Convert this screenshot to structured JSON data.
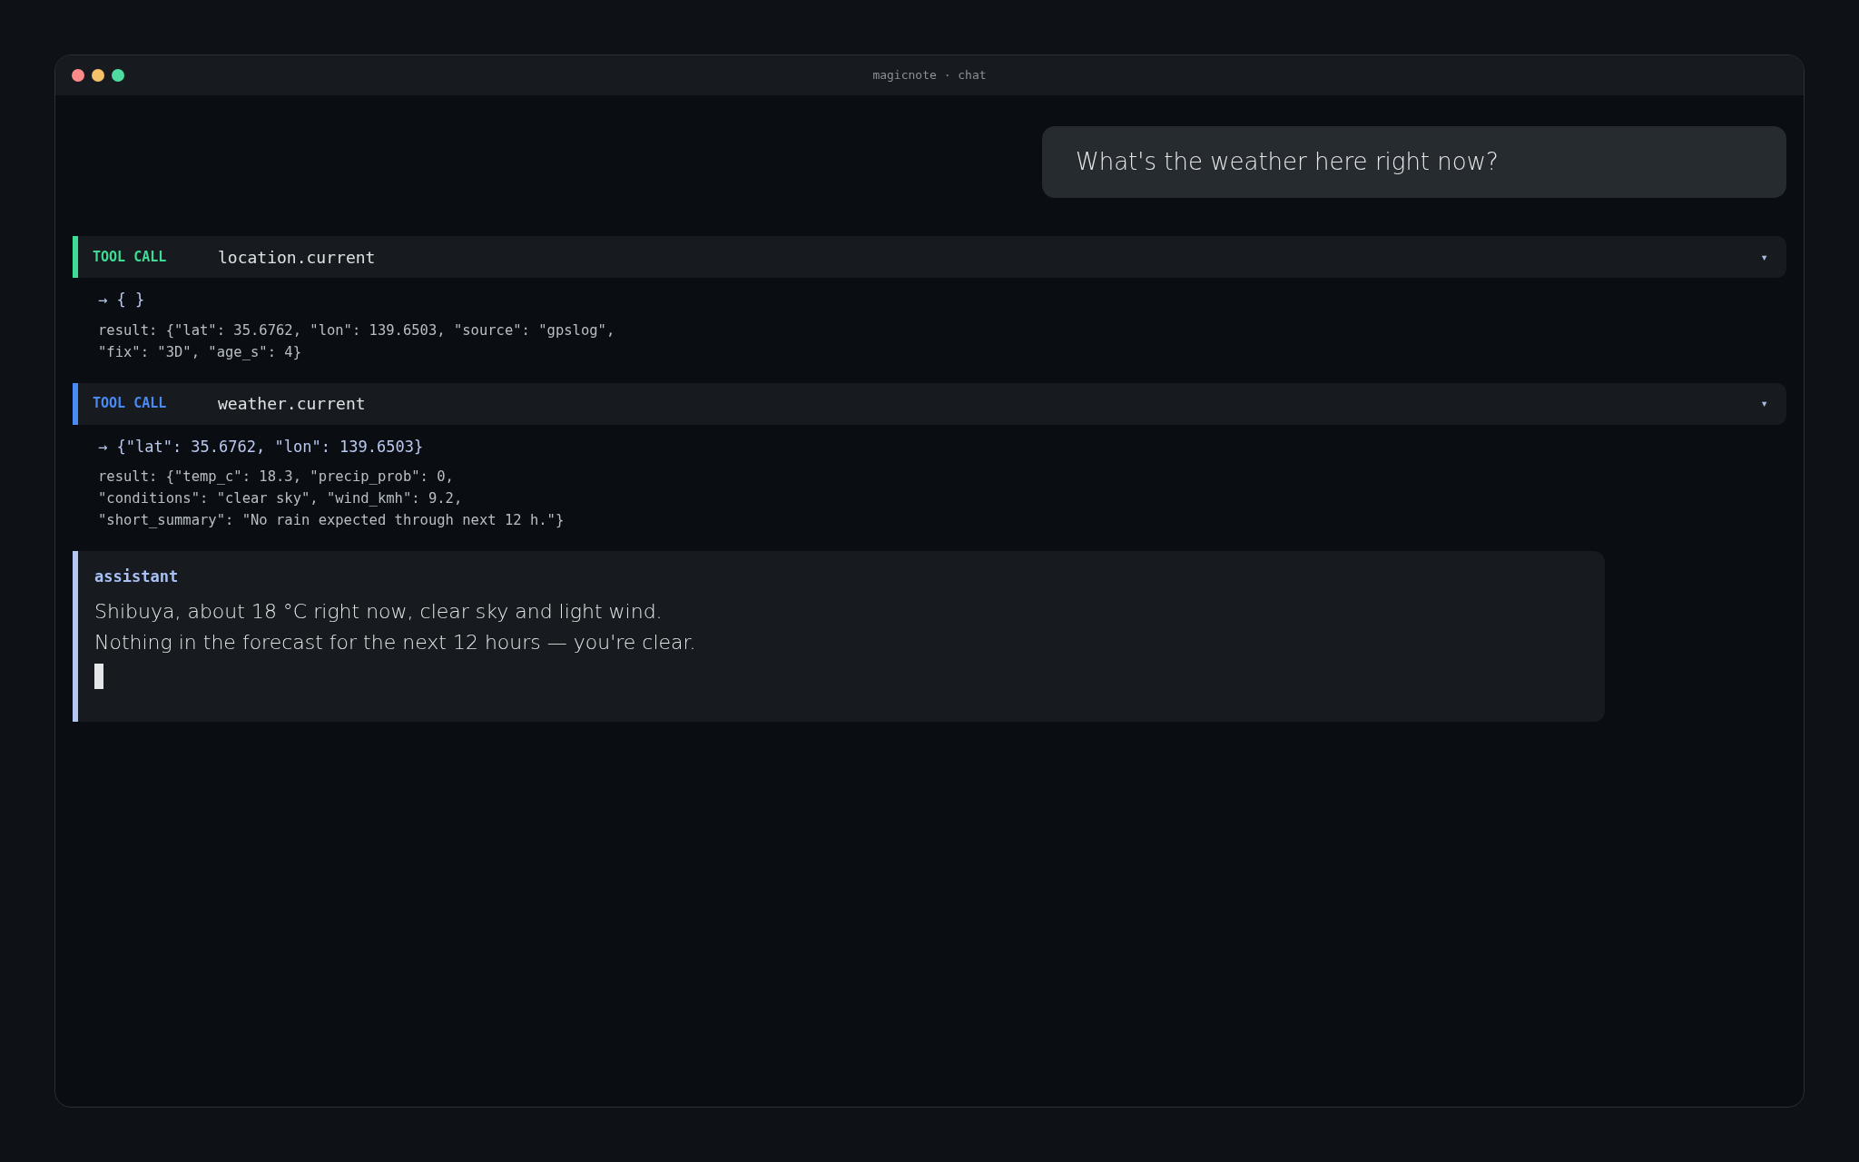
{
  "window": {
    "title": "magicnote · chat"
  },
  "messages": [
    {
      "kind": "user",
      "text": "What's the weather here right now?"
    },
    {
      "kind": "tool_call",
      "label": "TOOL CALL",
      "name": "location.current",
      "color": "#3ddc97",
      "expanded": true,
      "chevron": "▾",
      "args": "→ { }",
      "result": [
        "result: {\"lat\": 35.6762, \"lon\": 139.6503, \"source\": \"gpslog\",",
        "\"fix\": \"3D\", \"age_s\": 4}"
      ]
    },
    {
      "kind": "tool_call",
      "label": "TOOL CALL",
      "name": "weather.current",
      "color": "#4a8af4",
      "expanded": true,
      "chevron": "▾",
      "args": "→ {\"lat\": 35.6762, \"lon\": 139.6503}",
      "result": [
        "result: {\"temp_c\": 18.3, \"precip_prob\": 0,",
        "\"conditions\": \"clear sky\", \"wind_kmh\": 9.2,",
        "\"short_summary\": \"No rain expected through next 12 h.\"}"
      ]
    },
    {
      "kind": "assistant",
      "role": "assistant",
      "lines": [
        "Shibuya, about 18 °C right now, clear sky and light wind.",
        "Nothing in the forecast for the next 12 hours — you're clear."
      ],
      "streaming": true
    }
  ]
}
